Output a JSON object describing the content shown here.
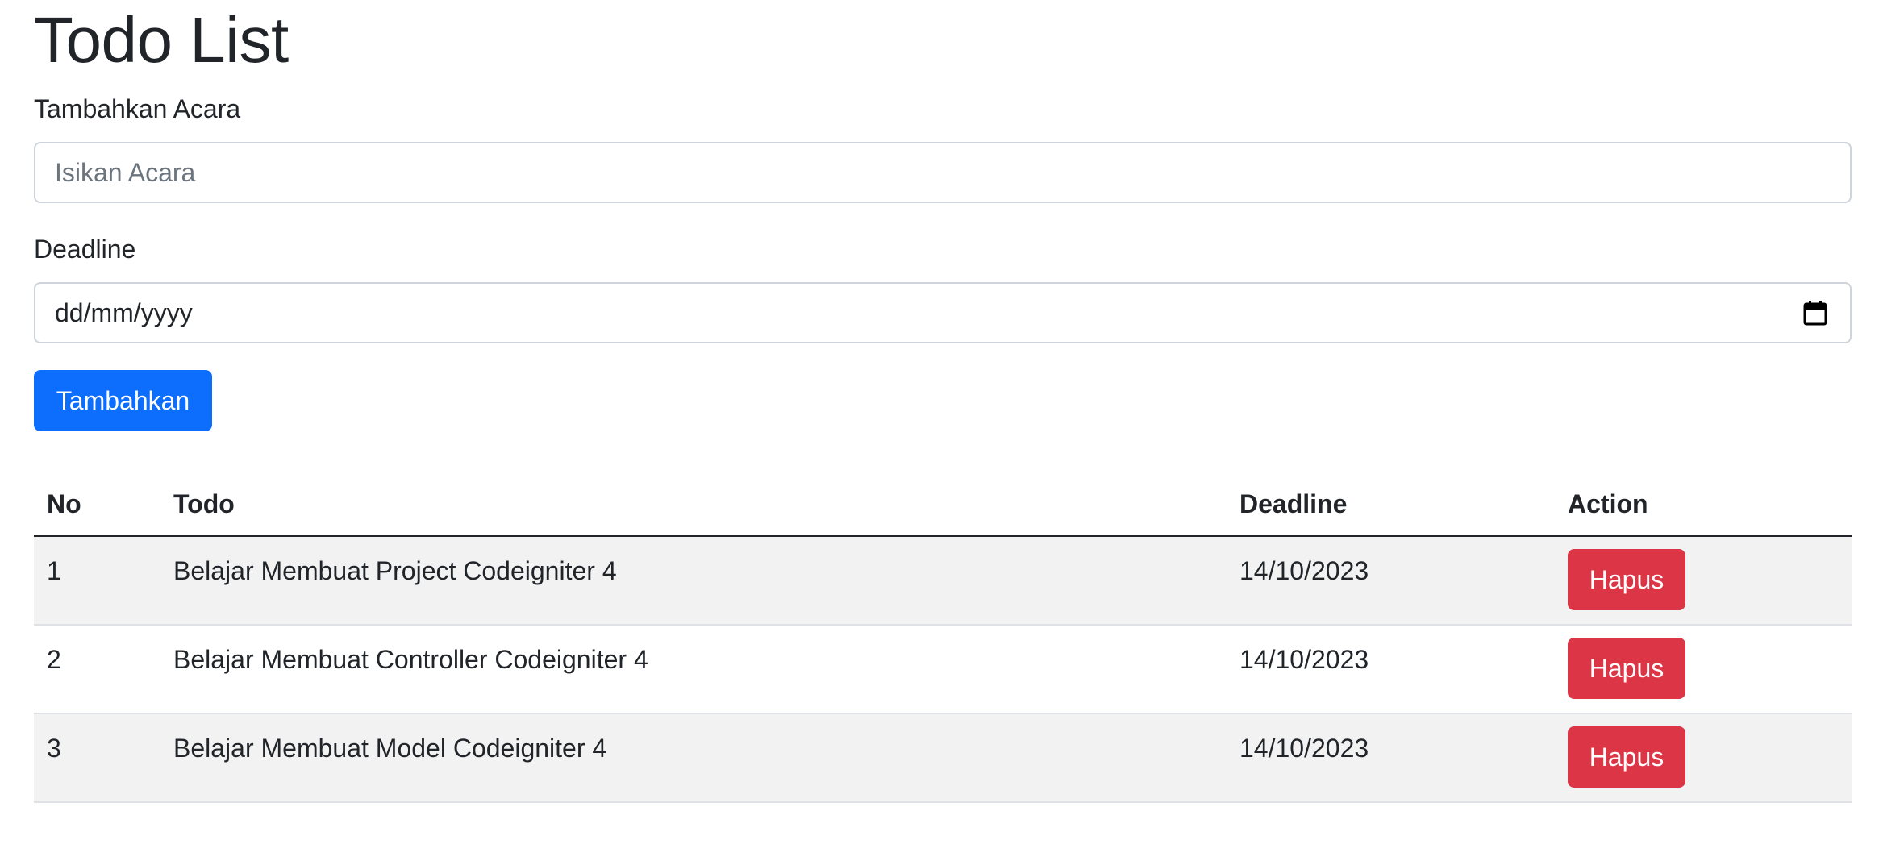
{
  "page": {
    "title": "Todo List"
  },
  "form": {
    "event_label": "Tambahkan Acara",
    "event_placeholder": "Isikan Acara",
    "event_value": "",
    "deadline_label": "Deadline",
    "deadline_placeholder": "dd/mm/yyyy",
    "submit_label": "Tambahkan"
  },
  "table": {
    "headers": [
      "No",
      "Todo",
      "Deadline",
      "Action"
    ],
    "rows": [
      {
        "no": "1",
        "todo": "Belajar Membuat Project Codeigniter 4",
        "deadline": "14/10/2023",
        "action": "Hapus"
      },
      {
        "no": "2",
        "todo": "Belajar Membuat Controller Codeigniter 4",
        "deadline": "14/10/2023",
        "action": "Hapus"
      },
      {
        "no": "3",
        "todo": "Belajar Membuat Model Codeigniter 4",
        "deadline": "14/10/2023",
        "action": "Hapus"
      }
    ]
  },
  "colors": {
    "primary": "#0d6efd",
    "danger": "#dc3545",
    "text": "#212529",
    "stripe": "#f2f2f2"
  },
  "icons": {
    "date_field": "calendar-icon"
  }
}
